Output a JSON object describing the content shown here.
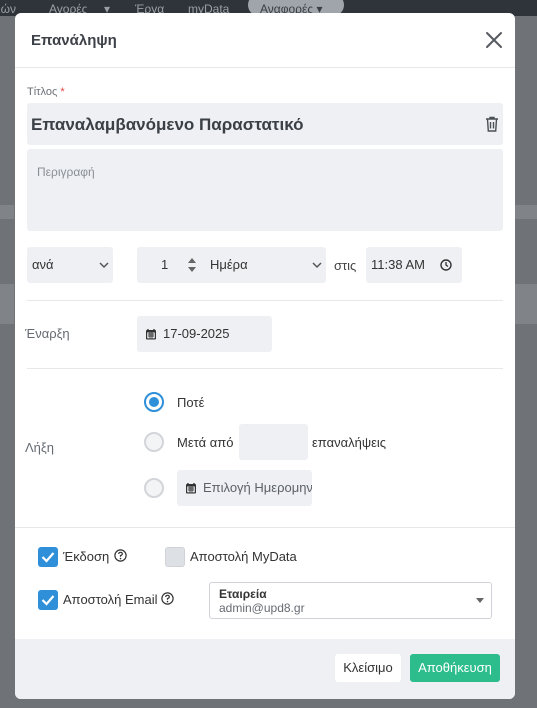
{
  "background_nav": {
    "items": [
      "ιών",
      "Αγορές",
      "Έργα",
      "myData"
    ],
    "active": "Αναφορές"
  },
  "modal": {
    "title": "Επανάληψη",
    "title_field": {
      "label": "Τίτλος",
      "required_mark": "*",
      "value": "Επαναλαμβανόμενο Παραστατικό"
    },
    "description": {
      "placeholder": "Περιγραφή"
    },
    "recurrence": {
      "frequency": "ανά",
      "interval": "1",
      "unit": "Ημέρα",
      "at_label": "στις",
      "time": "11:38 AM"
    },
    "start": {
      "label": "Έναρξη",
      "date": "17-09-2025"
    },
    "end": {
      "label": "Λήξη",
      "options": {
        "never": "Ποτέ",
        "after_prefix": "Μετά από",
        "after_suffix": "επαναλήψεις",
        "date_placeholder": "Επιλογή Ημερομηνίας"
      },
      "selected": "never"
    },
    "options": {
      "issue_label": "Έκδοση",
      "issue_checked": true,
      "mydata_label": "Αποστολή MyData",
      "mydata_checked": false,
      "email_label": "Αποστολή Email",
      "email_checked": true,
      "email_recipient_name": "Εταιρεία",
      "email_recipient_address": "admin@upd8.gr"
    },
    "footer": {
      "close_label": "Κλείσιμο",
      "save_label": "Αποθήκευση"
    }
  },
  "colors": {
    "accent": "#2f8fd8",
    "save": "#2dbd8d",
    "required": "#e2453c"
  }
}
